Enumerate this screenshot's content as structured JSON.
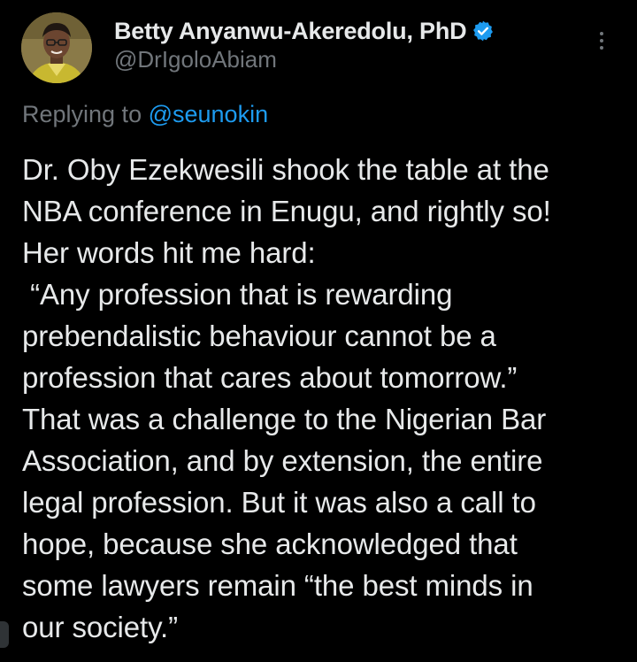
{
  "author": {
    "display_name": "Betty Anyanwu-Akeredolu, PhD",
    "handle": "@DrIgoloAbiam",
    "verified": true,
    "avatar_icon": "profile-photo",
    "verified_icon": "verified-badge-icon",
    "verified_color": "#1d9bf0"
  },
  "menu": {
    "more_icon": "more-vertical-icon"
  },
  "reply": {
    "prefix": "Replying to ",
    "mention": "@seunokin",
    "mention_color": "#1d9bf0"
  },
  "tweet": {
    "lines": [
      "Dr. Oby Ezekwesili shook the table at the",
      "NBA conference in Enugu, and rightly so!",
      "Her words hit me hard:",
      " “Any profession that is rewarding",
      "prebendalistic behaviour cannot be a",
      "profession that cares about tomorrow.”",
      "That was a challenge to the Nigerian Bar",
      "Association, and by extension, the entire",
      "legal profession. But it was also a call to",
      "hope, because she acknowledged that",
      "some lawyers remain “the best minds in",
      "our society.”"
    ]
  },
  "colors": {
    "background": "#000000",
    "primary_text": "#e7e9ea",
    "secondary_text": "#71767b",
    "accent": "#1d9bf0"
  }
}
